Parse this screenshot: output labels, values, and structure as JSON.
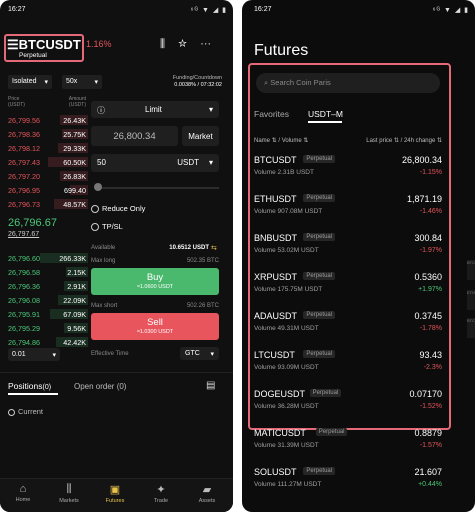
{
  "left": {
    "time": "16:27",
    "status_icons": "⁶ᴳ ▼ ◢ ▮",
    "pair": "BTCUSDT",
    "contract_type": "Perpetual",
    "change": "1.16%",
    "margin_mode": "Isolated",
    "leverage": "50x",
    "funding_label": "Funding/Countdown",
    "funding_value": "0.0038% / 07:32:02",
    "price_header": "Price\n(USDT)",
    "amount_header": "Amount\n(USDT)",
    "asks": [
      {
        "price": "26,799.56",
        "amount": "26.43K"
      },
      {
        "price": "26,798.36",
        "amount": "25.75K"
      },
      {
        "price": "26,798.12",
        "amount": "29.33K"
      },
      {
        "price": "26,797.43",
        "amount": "60.50K"
      },
      {
        "price": "26,797.20",
        "amount": "26.83K"
      },
      {
        "price": "26,796.95",
        "amount": "699.40"
      },
      {
        "price": "26,796.73",
        "amount": "48.57K"
      }
    ],
    "last_price": "26,796.67",
    "mark_price": "26,797.67",
    "bids": [
      {
        "price": "26,796.60",
        "amount": "266.33K"
      },
      {
        "price": "26,796.58",
        "amount": "2.15K"
      },
      {
        "price": "26,796.36",
        "amount": "2.91K"
      },
      {
        "price": "26,796.08",
        "amount": "22.09K"
      },
      {
        "price": "26,795.91",
        "amount": "67.09K"
      },
      {
        "price": "26,795.29",
        "amount": "9.56K"
      },
      {
        "price": "26,794.86",
        "amount": "42.42K"
      }
    ],
    "depth": "0.01",
    "order_type": "Limit",
    "price_input": "26,800.34",
    "market_btn": "Market",
    "qty_input": "50",
    "qty_unit": "USDT",
    "reduce_only": "Reduce Only",
    "tpsl": "TP/SL",
    "available_label": "Available",
    "available_value": "10.6512 USDT",
    "max_long_label": "Max long",
    "max_long_value": "502.35 BTC",
    "buy_label": "Buy",
    "buy_sub": "≈1.0600 USDT",
    "max_short_label": "Max short",
    "max_short_value": "502.26 BTC",
    "sell_label": "Sell",
    "sell_sub": "≈1.0300 USDT",
    "effective_label": "Effective Time",
    "effective_value": "GTC",
    "positions_tab": "Positions",
    "positions_count": "(0)",
    "open_order_tab": "Open order (0)",
    "current_label": "Current",
    "nav": [
      "Home",
      "Markets",
      "Futures",
      "Trade",
      "Assets"
    ]
  },
  "right": {
    "time": "16:27",
    "status_icons": "⁶ᴳ ▼ ◢ ▮",
    "title": "Futures",
    "search_placeholder": "Search Coin Paris",
    "tab_favorites": "Favorites",
    "tab_usdtm": "USDT–M",
    "col_name": "Name ⇅ / Volume ⇅",
    "col_price": "Last price ⇅ / 24h change ⇅",
    "edge_labels": [
      "BTC",
      "ETH",
      "BTC"
    ],
    "markets": [
      {
        "symbol": "BTCUSDT",
        "tag": "Perpetual",
        "volume": "Volume  2.31B  USDT",
        "price": "26,800.34",
        "change": "-1.15%",
        "dir": "down"
      },
      {
        "symbol": "ETHUSDT",
        "tag": "Perpetual",
        "volume": "Volume  907.08M  USDT",
        "price": "1,871.19",
        "change": "-1.46%",
        "dir": "down"
      },
      {
        "symbol": "BNBUSDT",
        "tag": "Perpetual",
        "volume": "Volume  53.02M  USDT",
        "price": "300.84",
        "change": "-1.97%",
        "dir": "down"
      },
      {
        "symbol": "XRPUSDT",
        "tag": "Perpetual",
        "volume": "Volume  175.75M  USDT",
        "price": "0.5360",
        "change": "+1.97%",
        "dir": "up"
      },
      {
        "symbol": "ADAUSDT",
        "tag": "Perpetual",
        "volume": "Volume  49.31M  USDT",
        "price": "0.3745",
        "change": "-1.78%",
        "dir": "down"
      },
      {
        "symbol": "LTCUSDT",
        "tag": "Perpetual",
        "volume": "Volume  93.09M  USDT",
        "price": "93.43",
        "change": "-2.3%",
        "dir": "down"
      },
      {
        "symbol": "DOGEUSDT",
        "tag": "Perpetual",
        "volume": "Volume  36.28M  USDT",
        "price": "0.07170",
        "change": "-1.52%",
        "dir": "down"
      },
      {
        "symbol": "MATICUSDT",
        "tag": "Perpetual",
        "volume": "Volume  31.39M  USDT",
        "price": "0.8879",
        "change": "-1.57%",
        "dir": "down"
      },
      {
        "symbol": "SOLUSDT",
        "tag": "Perpetual",
        "volume": "Volume  111.27M  USDT",
        "price": "21.607",
        "change": "+0.44%",
        "dir": "up"
      }
    ]
  },
  "colors": {
    "up": "#4cc77a",
    "down": "#e2555c",
    "accent": "#e8c24a",
    "highlight": "#e36a78"
  }
}
